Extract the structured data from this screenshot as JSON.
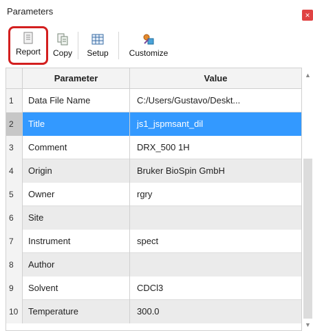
{
  "window": {
    "title": "Parameters",
    "close_glyph": "×"
  },
  "toolbar": {
    "report_label": "Report",
    "copy_label": "Copy",
    "setup_label": "Setup",
    "customize_label": "Customize"
  },
  "table": {
    "header": {
      "parameter": "Parameter",
      "value": "Value"
    },
    "rows": [
      {
        "n": "1",
        "parameter": "Data File Name",
        "value": "C:/Users/Gustavo/Deskt..."
      },
      {
        "n": "2",
        "parameter": "Title",
        "value": "js1_jspmsant_dil"
      },
      {
        "n": "3",
        "parameter": "Comment",
        "value": "DRX_500  1H"
      },
      {
        "n": "4",
        "parameter": "Origin",
        "value": "Bruker BioSpin GmbH"
      },
      {
        "n": "5",
        "parameter": "Owner",
        "value": "rgry"
      },
      {
        "n": "6",
        "parameter": "Site",
        "value": ""
      },
      {
        "n": "7",
        "parameter": "Instrument",
        "value": "spect"
      },
      {
        "n": "8",
        "parameter": "Author",
        "value": ""
      },
      {
        "n": "9",
        "parameter": "Solvent",
        "value": "CDCl3"
      },
      {
        "n": "10",
        "parameter": "Temperature",
        "value": "300.0"
      }
    ]
  },
  "colors": {
    "selection": "#3399ff",
    "highlight_border": "#d31f1f",
    "close": "#e04343"
  },
  "icons": [
    "report-icon",
    "copy-icon",
    "setup-icon",
    "customize-icon",
    "close-icon",
    "scroll-up-icon",
    "scroll-down-icon"
  ]
}
